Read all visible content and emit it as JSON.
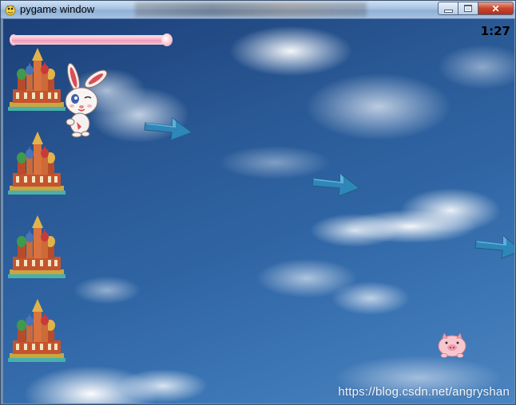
{
  "window": {
    "title": "pygame window",
    "icon": "pygame-snake-icon",
    "buttons": [
      "minimize-icon",
      "maximize-icon",
      "close-icon"
    ]
  },
  "hud": {
    "timer": "1:27",
    "health_fraction": 1.0,
    "health_color": "#f29ab4"
  },
  "game": {
    "castles": 4,
    "castle_icon": "st-basil-cathedral-icon",
    "player_icon": "rabbit-icon",
    "enemy_icons": [
      "arrow-icon",
      "arrow-icon",
      "arrow-icon"
    ],
    "pickup_icon": "pig-icon",
    "arrow_color": "#2f86b8"
  },
  "watermark": "https://blog.csdn.net/angryshan"
}
